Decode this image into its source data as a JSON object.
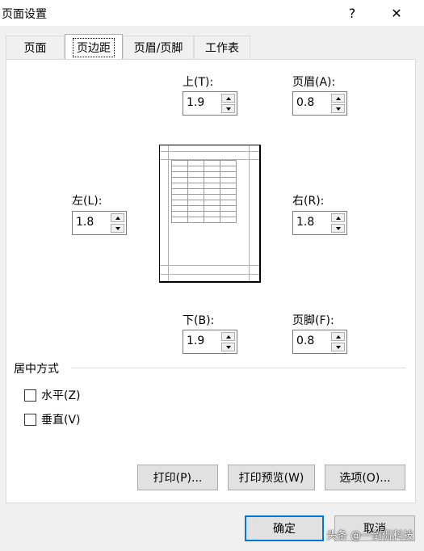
{
  "dialog": {
    "title": "页面设置",
    "help": "?",
    "close": "✕"
  },
  "tabs": [
    {
      "label": "页面",
      "active": false
    },
    {
      "label": "页边距",
      "active": true
    },
    {
      "label": "页眉/页脚",
      "active": false
    },
    {
      "label": "工作表",
      "active": false
    }
  ],
  "margins": {
    "top": {
      "label": "上(T):",
      "value": "1.9"
    },
    "header": {
      "label": "页眉(A):",
      "value": "0.8"
    },
    "left": {
      "label": "左(L):",
      "value": "1.8"
    },
    "right": {
      "label": "右(R):",
      "value": "1.8"
    },
    "bottom": {
      "label": "下(B):",
      "value": "1.9"
    },
    "footer": {
      "label": "页脚(F):",
      "value": "0.8"
    }
  },
  "centering": {
    "title": "居中方式",
    "horizontal": {
      "label": "水平(Z)",
      "checked": false
    },
    "vertical": {
      "label": "垂直(V)",
      "checked": false
    }
  },
  "buttons": {
    "print": "打印(P)...",
    "preview": "打印预览(W)",
    "options": "选项(O)...",
    "ok": "确定",
    "cancel": "取消"
  },
  "watermark": "头条 @一剑侃科技",
  "icons": [
    "close-icon",
    "spin-up-icon",
    "spin-down-icon",
    "page-preview-icon"
  ],
  "colors": {
    "accent": "#0078d7",
    "window": "#f0f0f0",
    "panel": "#ffffff"
  }
}
